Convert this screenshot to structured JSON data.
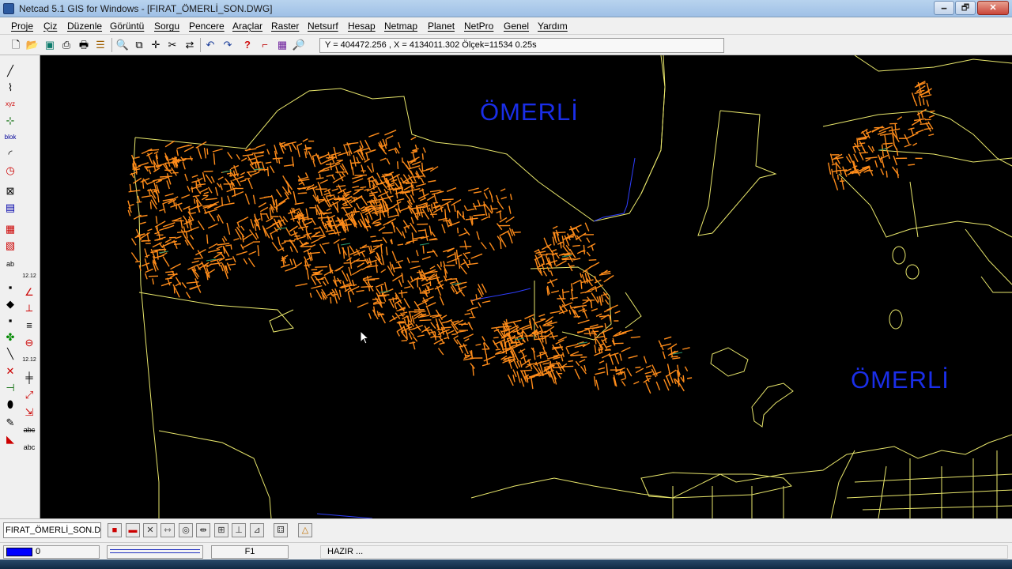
{
  "window": {
    "title": "Netcad 5.1 GIS for Windows - [FIRAT_ÖMERLİ_SON.DWG]",
    "controls": {
      "minimize": "🗕",
      "maximize": "🗗",
      "close": "✕"
    }
  },
  "menu": [
    "Proje",
    "Çiz",
    "Düzenle",
    "Görüntü",
    "Sorgu",
    "Pencere",
    "Araçlar",
    "Raster",
    "Netsurf",
    "Hesap",
    "Netmap",
    "Planet",
    "NetPro",
    "Genel",
    "Yardım"
  ],
  "toolbar": {
    "coord_readout": "Y = 404472.256 , X = 4134011.302  Ölçek=11534   0.25s",
    "icons": [
      "new-file-icon",
      "open-folder-icon",
      "save-icon",
      "print-preview-icon",
      "print-icon",
      "layers-icon",
      "zoom-icon",
      "zoom-window-icon",
      "pan-icon",
      "scissors-icon",
      "move-icon",
      "undo-icon",
      "redo-icon",
      "help-icon",
      "polyline-icon",
      "raster-icon",
      "search-icon"
    ]
  },
  "map": {
    "labels": [
      {
        "text": "ÖMERLİ"
      },
      {
        "text": "ÖMERLİ"
      }
    ],
    "colors": {
      "background": "#000000",
      "parcel_lines": "#e8e66b",
      "hatch": "#ff8c1a",
      "labels": "#1a2ee8",
      "water": "#2f3fff"
    }
  },
  "drawing_bar": {
    "tab_label": "FIRAT_ÖMERLİ_SON.DWG"
  },
  "status": {
    "layer": "0",
    "function_key": "F1",
    "state": "HAZIR ..."
  }
}
